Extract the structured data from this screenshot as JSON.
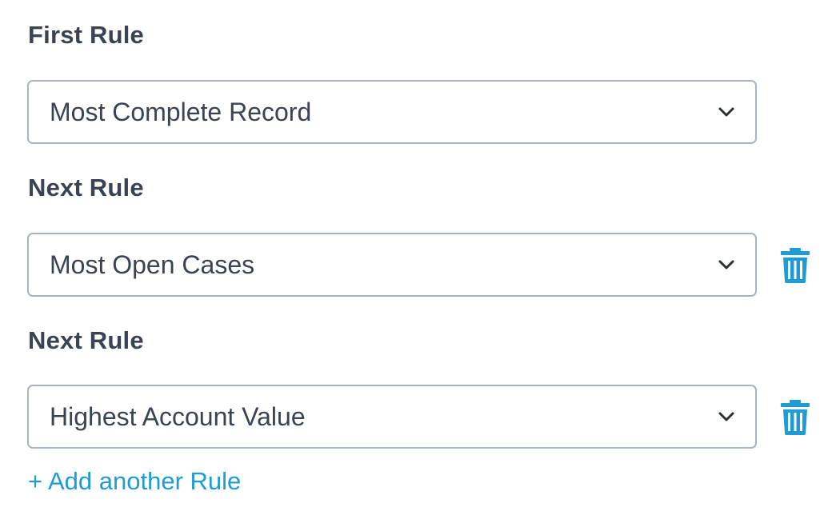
{
  "rules": [
    {
      "label": "First Rule",
      "selected": "Most Complete Record",
      "deletable": false
    },
    {
      "label": "Next Rule",
      "selected": "Most Open Cases",
      "deletable": true
    },
    {
      "label": "Next Rule",
      "selected": "Highest Account Value",
      "deletable": true
    }
  ],
  "add_rule_link": "+ Add another Rule",
  "icons": {
    "dropdown": "chevron-down-icon",
    "delete": "trash-icon"
  },
  "colors": {
    "label_text": "#3a4352",
    "border": "#a9b3c2",
    "accent": "#1f9bd6"
  }
}
